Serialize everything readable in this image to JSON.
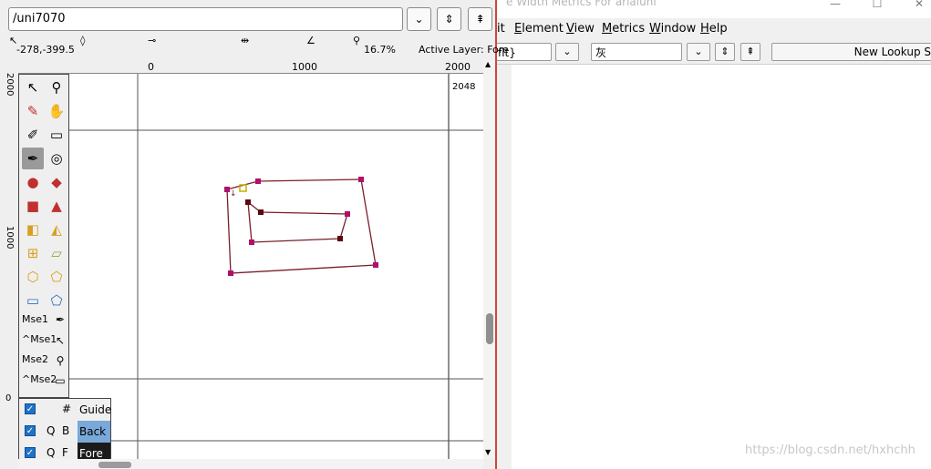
{
  "metrics_window": {
    "title": "e Width Metrics For arialuni",
    "window_controls": {
      "minimize": "—",
      "maximize": "☐",
      "close": "✕"
    },
    "menu": [
      "it",
      "Element",
      "View",
      "Metrics",
      "Window",
      "Help"
    ],
    "menu_underline": [
      "",
      "E",
      "V",
      "M",
      "W",
      "H"
    ],
    "script_field": "flt}",
    "glyph_field": "灰",
    "new_lookup_label": "New Lookup S"
  },
  "watermark": "https://blog.csdn.net/hxhchh",
  "glyph_window": {
    "glyph_name": "/uni7070",
    "buttons": {
      "dropdown": "⌄",
      "prev": "⇕",
      "next": "⇞"
    },
    "status": {
      "cursor": "-278,-399.5",
      "zoom": "16.7%",
      "active_layer": "Active Layer: Fore"
    },
    "ruler_h": [
      "0",
      "1000",
      "2000"
    ],
    "ruler_v": [
      "2000",
      "1000",
      "0"
    ],
    "advance_label": "2048",
    "tools": {
      "mse": [
        "Mse1",
        "^Mse1",
        "Mse2",
        "^Mse2"
      ]
    },
    "layers": [
      {
        "c1": "#",
        "c2": "",
        "name": "Guide",
        "checked": true
      },
      {
        "c1": "Q",
        "c2": "B",
        "name": "Back",
        "checked": true
      },
      {
        "c1": "Q",
        "c2": "F",
        "name": "Fore",
        "checked": true
      }
    ]
  },
  "colors": {
    "outline": "#7a1f2b",
    "point": "#b0106a",
    "control": "#5a0a0a",
    "start_point": "#c0b000",
    "layer_back_bg": "#7aa8d8",
    "layer_fore_bg": "#1b1b1b",
    "window_border": "#d0453a"
  }
}
